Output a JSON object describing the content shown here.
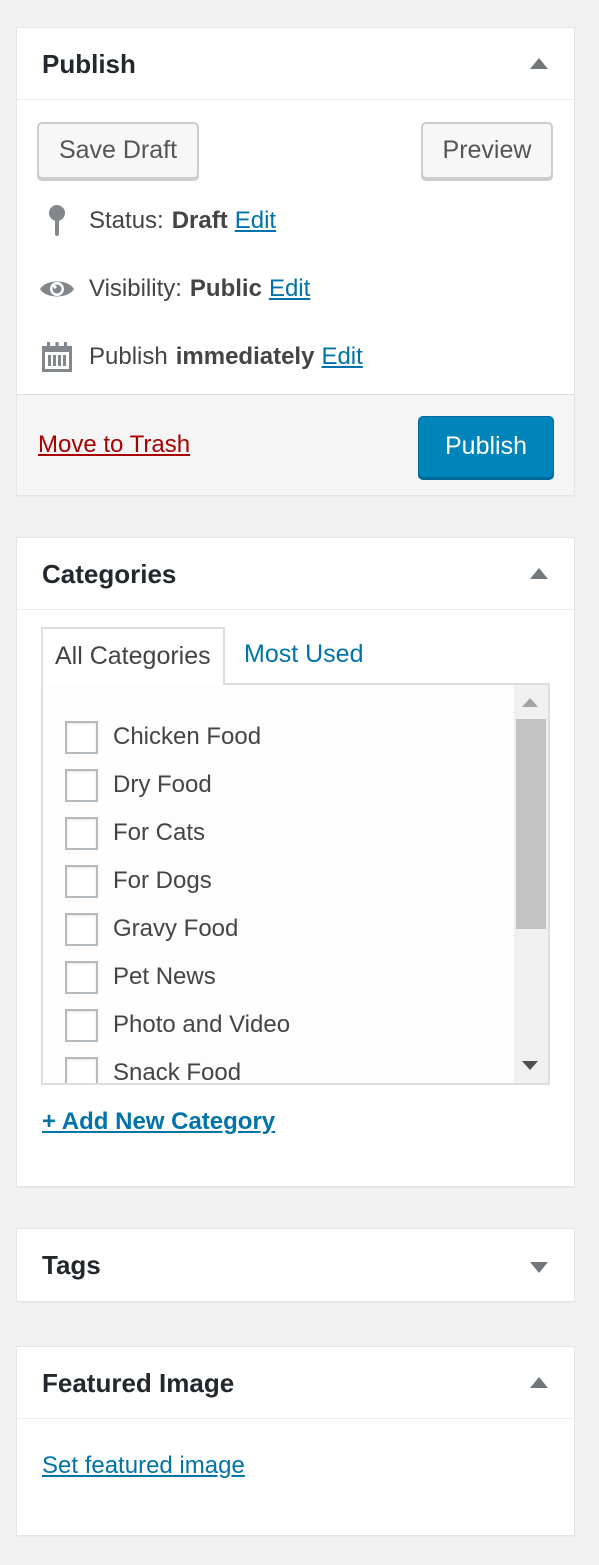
{
  "publish": {
    "title": "Publish",
    "save_draft": "Save Draft",
    "preview": "Preview",
    "status_label": "Status:",
    "status_value": "Draft",
    "visibility_label": "Visibility:",
    "visibility_value": "Public",
    "schedule_label": "Publish",
    "schedule_value": "immediately",
    "edit_label": "Edit",
    "trash": "Move to Trash",
    "publish_button": "Publish"
  },
  "categories": {
    "title": "Categories",
    "tab_all": "All Categories",
    "tab_most_used": "Most Used",
    "items": [
      {
        "label": "Chicken Food",
        "checked": false
      },
      {
        "label": "Dry Food",
        "checked": false
      },
      {
        "label": "For Cats",
        "checked": false
      },
      {
        "label": "For Dogs",
        "checked": false
      },
      {
        "label": "Gravy Food",
        "checked": false
      },
      {
        "label": "Pet News",
        "checked": false
      },
      {
        "label": "Photo and Video",
        "checked": false
      },
      {
        "label": "Snack Food",
        "checked": false
      }
    ],
    "add_new": "+ Add New Category"
  },
  "tags": {
    "title": "Tags"
  },
  "featured": {
    "title": "Featured Image",
    "set_link": "Set featured image"
  },
  "colors": {
    "link": "#0073aa",
    "trash": "#aa0000",
    "primary_button": "#0085ba",
    "icon": "#82878c"
  }
}
